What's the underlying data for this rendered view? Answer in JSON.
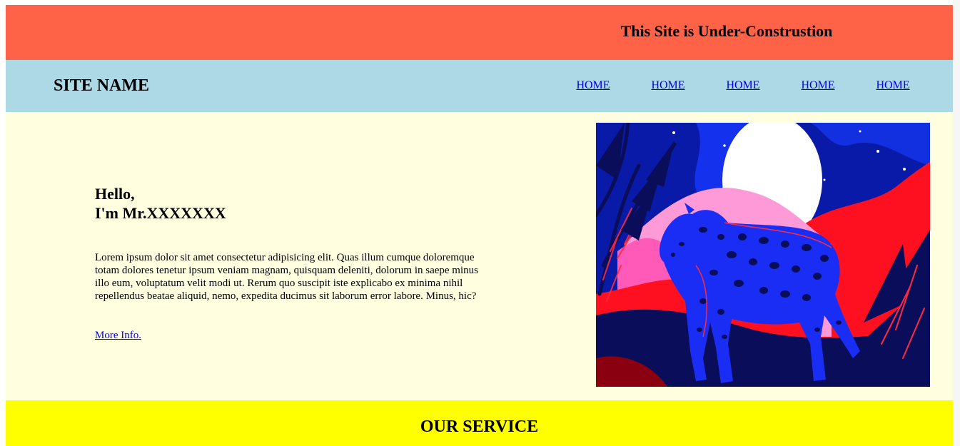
{
  "banner": {
    "text": "This Site is Under-Construstion"
  },
  "navbar": {
    "site_name": "SITE NAME",
    "links": [
      {
        "label": "HOME"
      },
      {
        "label": "HOME"
      },
      {
        "label": "HOME"
      },
      {
        "label": "HOME"
      },
      {
        "label": "HOME"
      }
    ]
  },
  "hero": {
    "greeting_line1": "Hello,",
    "greeting_line2": "I'm Mr.XXXXXXX",
    "bio": "Lorem ipsum dolor sit amet consectetur adipisicing elit. Quas illum cumque doloremque totam dolores tenetur ipsum veniam magnam, quisquam deleniti, dolorum in saepe minus illo eum, voluptatum velit modi ut. Rerum quo suscipit iste explicabo ex minima nihil repellendus beatae aliquid, nemo, expedita ducimus sit laborum error labore. Minus, hic?",
    "more_info": "More Info.",
    "image": "leopard-illustration"
  },
  "service": {
    "title": "OUR SERVICE"
  },
  "colors": {
    "banner_bg": "#ff6347",
    "navbar_bg": "#add8e6",
    "hero_bg": "#ffffe0",
    "service_bg": "#ffff00",
    "link": "#0000ee"
  }
}
